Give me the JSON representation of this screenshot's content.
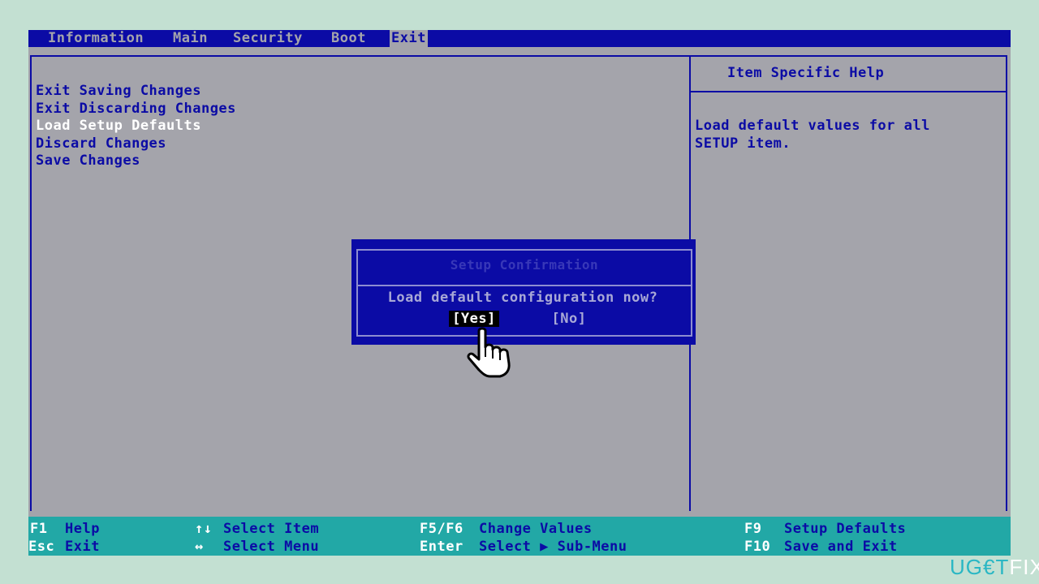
{
  "menubar": {
    "tabs": [
      {
        "label": "Information"
      },
      {
        "label": "Main"
      },
      {
        "label": "Security"
      },
      {
        "label": "Boot"
      },
      {
        "label": "Exit",
        "active": true
      }
    ]
  },
  "exit_menu": {
    "items": [
      {
        "label": "Exit Saving Changes"
      },
      {
        "label": "Exit Discarding Changes"
      },
      {
        "label": "Load Setup Defaults",
        "selected": true
      },
      {
        "label": "Discard Changes"
      },
      {
        "label": "Save Changes"
      }
    ]
  },
  "help_panel": {
    "title": "Item Specific Help",
    "text_line1": "Load default values for all",
    "text_line2": "SETUP item."
  },
  "dialog": {
    "title": "Setup Confirmation",
    "question": "Load default configuration now?",
    "yes_label": "[Yes]",
    "no_label": "[No]"
  },
  "footer": {
    "row1": [
      {
        "key": "F1",
        "desc": "Help"
      },
      {
        "key": "↑↓",
        "desc": "Select Item"
      },
      {
        "key": "F5/F6",
        "desc": "Change Values"
      },
      {
        "key": "F9",
        "desc": "Setup Defaults"
      }
    ],
    "row2": [
      {
        "key": "Esc",
        "desc": "Exit"
      },
      {
        "key": "↔",
        "desc": "Select Menu"
      },
      {
        "key": "Enter",
        "desc": "Select ▶ Sub-Menu"
      },
      {
        "key": "F10",
        "desc": "Save and Exit"
      }
    ]
  },
  "watermark": {
    "prefix": "UG",
    "mid": "€T",
    "suffix": "FIX"
  },
  "colors": {
    "bios_blue": "#0b0ba5",
    "bios_gray": "#a4a4ab",
    "footer_teal": "#22a8a6",
    "page_background": "#c3e0d2"
  }
}
